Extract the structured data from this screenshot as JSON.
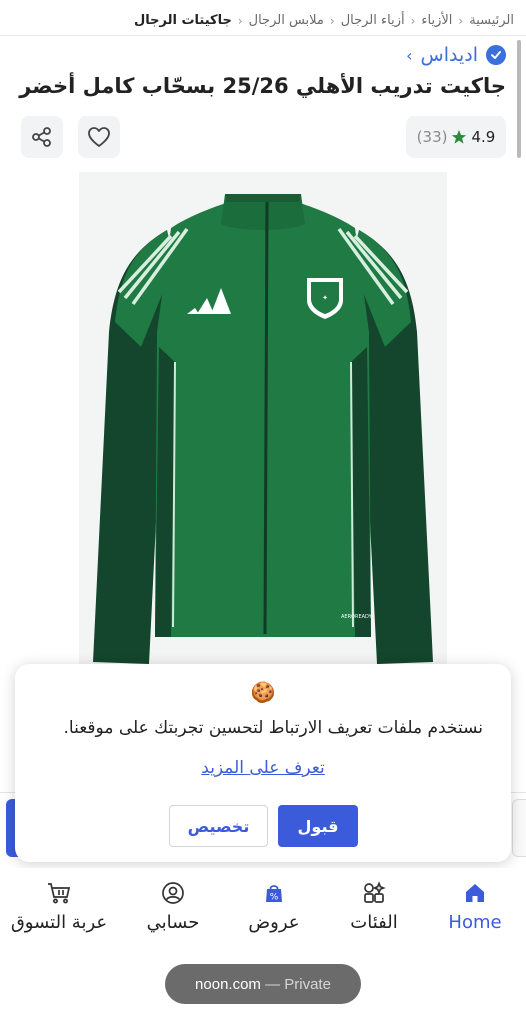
{
  "breadcrumb": {
    "items": [
      "الرئيسية",
      "الأزياء",
      "أزياء الرجال",
      "ملابس الرجال",
      "جاكيتات الرجال"
    ],
    "separator": "‹"
  },
  "product": {
    "brand": "اديداس",
    "brand_chevron": "›",
    "title": "جاكيت تدريب الأهلي 25/26 بسحّاب كامل أخضر",
    "rating_value": "4.9",
    "rating_count": "(33)",
    "image_alt": "green adidas track jacket",
    "jacket_tag": "AEROREADY"
  },
  "icons": {
    "verified": "verified-check-icon",
    "star": "star-icon",
    "heart": "heart-icon",
    "share": "share-icon"
  },
  "cookie_banner": {
    "emoji": "🍪",
    "text": "نستخدم ملفات تعريف الارتباط لتحسين تجربتك على موقعنا.",
    "learn_more": "تعرف على المزيد",
    "accept_label": "قبول",
    "customize_label": "تخصيص"
  },
  "bottom_nav": {
    "items": [
      {
        "label": "Home",
        "icon": "home-icon",
        "active": true
      },
      {
        "label": "الفئات",
        "icon": "categories-icon",
        "active": false
      },
      {
        "label": "عروض",
        "icon": "offers-icon",
        "active": false
      },
      {
        "label": "حسابي",
        "icon": "account-icon",
        "active": false
      },
      {
        "label": "عربة التسوق",
        "icon": "cart-icon",
        "active": false
      }
    ]
  },
  "browser": {
    "domain": "noon.com",
    "mode": "— Private"
  },
  "colors": {
    "accent": "#3b5bdb",
    "verified": "#3b6fdc",
    "star": "#2e8b3d",
    "jacket": "#1f7a43",
    "jacket_dark": "#14452d"
  }
}
